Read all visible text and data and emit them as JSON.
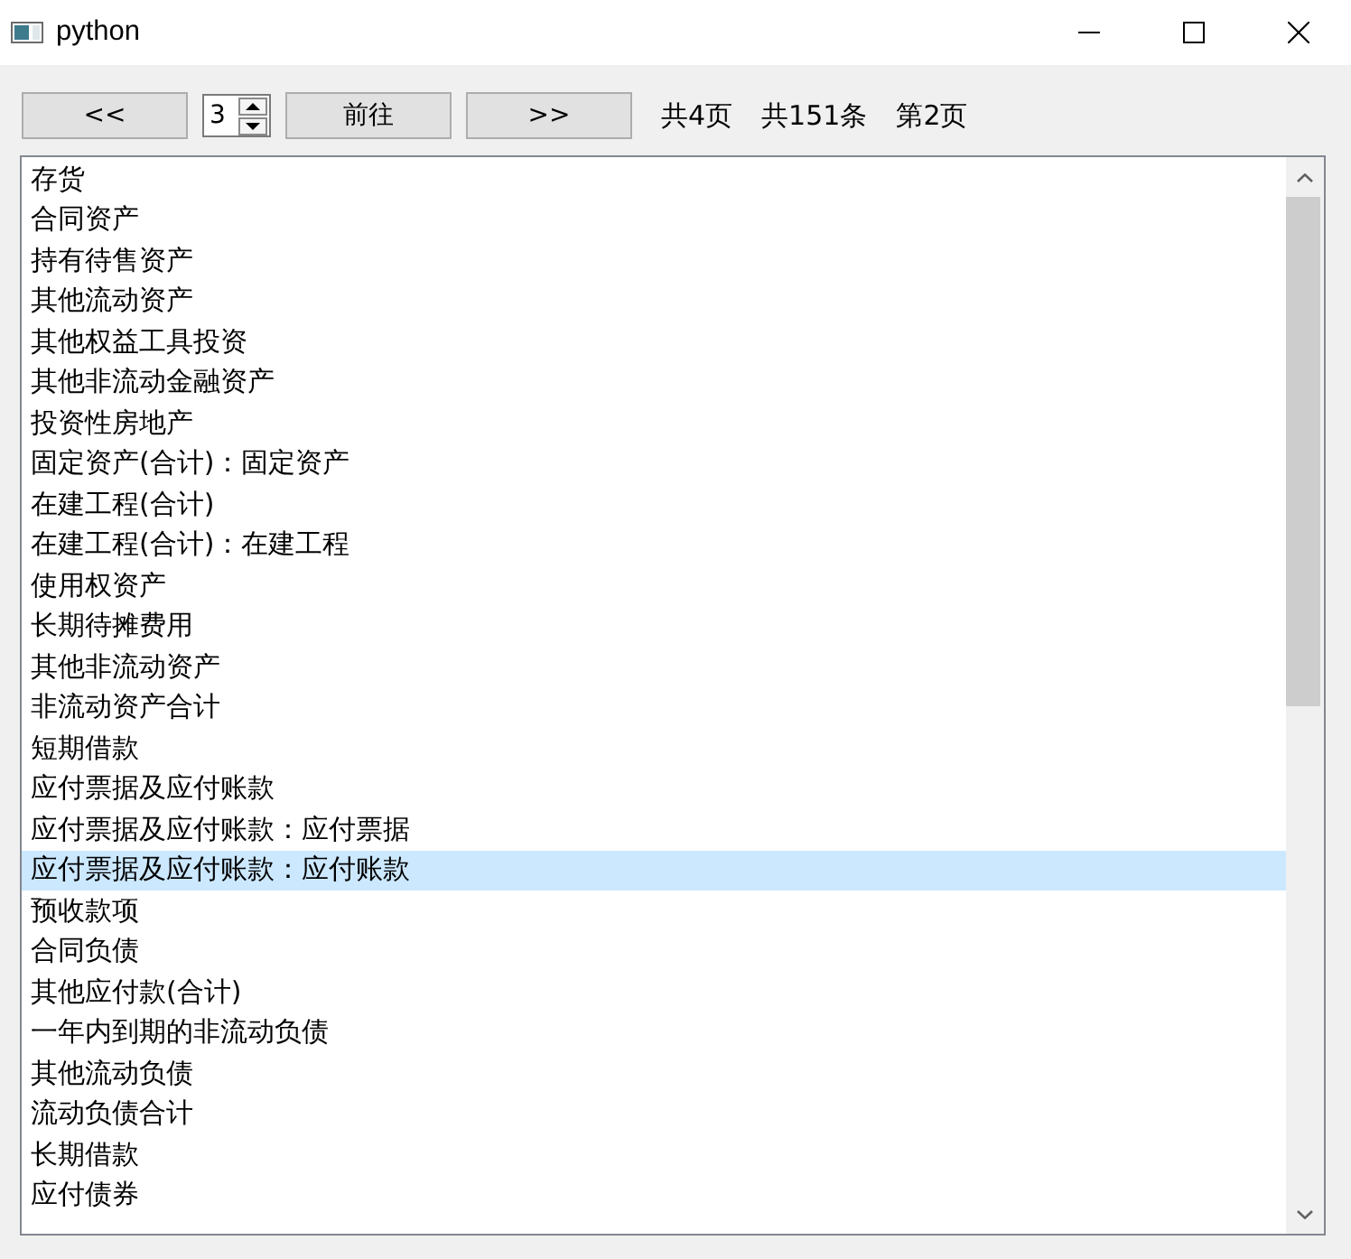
{
  "window": {
    "title": "python"
  },
  "toolbar": {
    "prev_button": "<<",
    "page_spinbox": {
      "value": "3"
    },
    "go_button": "前往",
    "next_button": ">>",
    "total_pages": "共4页",
    "total_records": "共151条",
    "current_page": "第2页"
  },
  "list": {
    "items": [
      {
        "label": "存货",
        "selected": false
      },
      {
        "label": "合同资产",
        "selected": false
      },
      {
        "label": "持有待售资产",
        "selected": false
      },
      {
        "label": "其他流动资产",
        "selected": false
      },
      {
        "label": "其他权益工具投资",
        "selected": false
      },
      {
        "label": "其他非流动金融资产",
        "selected": false
      },
      {
        "label": "投资性房地产",
        "selected": false
      },
      {
        "label": "固定资产(合计)：固定资产",
        "selected": false
      },
      {
        "label": "在建工程(合计)",
        "selected": false
      },
      {
        "label": "在建工程(合计)：在建工程",
        "selected": false
      },
      {
        "label": "使用权资产",
        "selected": false
      },
      {
        "label": "长期待摊费用",
        "selected": false
      },
      {
        "label": "其他非流动资产",
        "selected": false
      },
      {
        "label": "非流动资产合计",
        "selected": false
      },
      {
        "label": "短期借款",
        "selected": false
      },
      {
        "label": "应付票据及应付账款",
        "selected": false
      },
      {
        "label": "应付票据及应付账款：应付票据",
        "selected": false
      },
      {
        "label": "应付票据及应付账款：应付账款",
        "selected": true
      },
      {
        "label": "预收款项",
        "selected": false
      },
      {
        "label": "合同负债",
        "selected": false
      },
      {
        "label": "其他应付款(合计)",
        "selected": false
      },
      {
        "label": "一年内到期的非流动负债",
        "selected": false
      },
      {
        "label": "其他流动负债",
        "selected": false
      },
      {
        "label": "流动负债合计",
        "selected": false
      },
      {
        "label": "长期借款",
        "selected": false
      },
      {
        "label": "应付债券",
        "selected": false
      }
    ]
  }
}
